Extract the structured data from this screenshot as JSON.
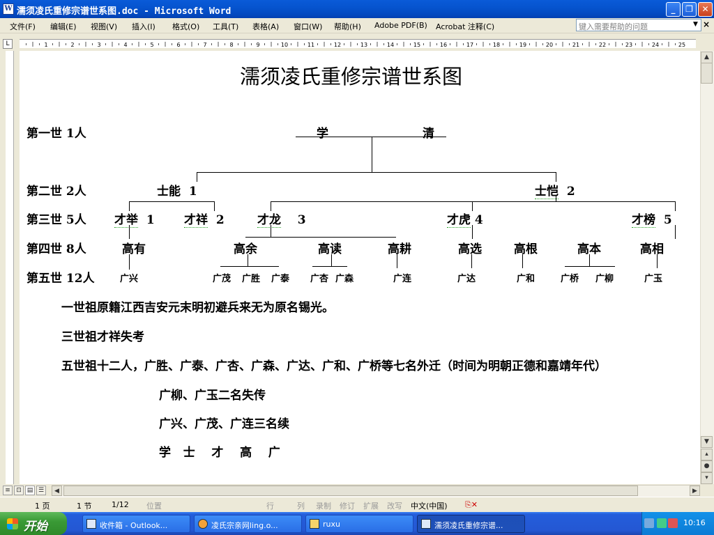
{
  "window": {
    "title": "濡须凌氏重修宗谱世系图.doc - Microsoft Word",
    "buttons": {
      "minimize": "_",
      "restore": "❐",
      "close": "✕"
    }
  },
  "menu": {
    "items": [
      "文件(F)",
      "编辑(E)",
      "视图(V)",
      "插入(I)",
      "格式(O)",
      "工具(T)",
      "表格(A)",
      "窗口(W)",
      "帮助(H)",
      "Adobe PDF(B)",
      "Acrobat 注释(C)"
    ],
    "help_placeholder": "键入需要帮助的问题"
  },
  "ruler": {
    "numbers": [
      "1",
      "2",
      "3",
      "4",
      "5",
      "6",
      "7",
      "8",
      "9",
      "10",
      "11",
      "12",
      "13",
      "14",
      "15",
      "16",
      "17",
      "18",
      "19",
      "20",
      "21",
      "22",
      "23",
      "24",
      "25"
    ]
  },
  "document": {
    "title": "濡须凌氏重修宗谱世系图",
    "generations": [
      "第一世  1人",
      "第二世  2人",
      "第三世 5人",
      "第四世 8人",
      "第五世 12人"
    ],
    "gen1": {
      "left": "学",
      "right": "清"
    },
    "gen2": [
      {
        "name": "士能",
        "num": "1"
      },
      {
        "name": "士恺",
        "num": "2"
      }
    ],
    "gen3": [
      {
        "name": "才举",
        "num": "1"
      },
      {
        "name": "才祥",
        "num": "2"
      },
      {
        "name": "才龙",
        "num": "3"
      },
      {
        "name": "才虎",
        "num": "4"
      },
      {
        "name": "才榜",
        "num": "5"
      }
    ],
    "gen4": [
      "高有",
      "高余",
      "高读",
      "高耕",
      "高选",
      "高根",
      "高本",
      "高相"
    ],
    "gen5": [
      "广兴",
      "广茂",
      "广胜",
      "广泰",
      "广杏",
      "广森",
      "广连",
      "广达",
      "广和",
      "广桥",
      "广柳",
      "广玉"
    ],
    "notes": [
      "一世祖原籍江西吉安元末明初避兵来无为原名锡光。",
      "三世祖才祥失考",
      "五世祖十二人，广胜、广泰、广杏、广森、广达、广和、广桥等七名外迁（时间为明朝正德和嘉靖年代）",
      "广柳、广玉二名失传",
      "广兴、广茂、广连三名续",
      "学   士    才    高    广"
    ]
  },
  "statusbar": {
    "page": "1 页",
    "section": "1 节",
    "pages": "1/12",
    "position": "位置",
    "line": "行",
    "column": "列",
    "modes": [
      "录制",
      "修订",
      "扩展",
      "改写"
    ],
    "language": "中文(中国)"
  },
  "taskbar": {
    "start": "开始",
    "tasks": [
      {
        "label": "收件箱 - Outlook..."
      },
      {
        "label": "凌氏宗亲网ling.o..."
      },
      {
        "label": "ruxu"
      },
      {
        "label": "濡须凌氏重修宗谱..."
      }
    ],
    "clock": "10:16"
  }
}
